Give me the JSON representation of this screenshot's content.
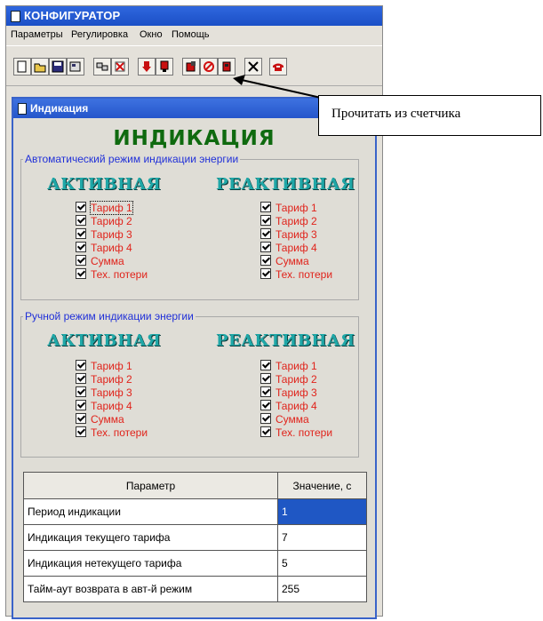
{
  "app": {
    "title": "КОНФИГУРАТОР"
  },
  "menu": [
    "Параметры",
    "Регулировка",
    "Окно",
    "Помощь"
  ],
  "child": {
    "title": "Индикация",
    "heading": "ИНДИКАЦИЯ"
  },
  "auto_group": {
    "legend": "Автоматический режим индикации энергии",
    "active_title": "АКТИВНАЯ",
    "reactive_title": "РЕАКТИВНАЯ",
    "active": [
      "Тариф 1",
      "Тариф 2",
      "Тариф 3",
      "Тариф 4",
      "Сумма",
      "Тех. потери"
    ],
    "reactive": [
      "Тариф 1",
      "Тариф 2",
      "Тариф 3",
      "Тариф 4",
      "Сумма",
      "Тех. потери"
    ]
  },
  "manual_group": {
    "legend": "Ручной режим индикации энергии",
    "active_title": "АКТИВНАЯ",
    "reactive_title": "РЕАКТИВНАЯ",
    "active": [
      "Тариф 1",
      "Тариф 2",
      "Тариф 3",
      "Тариф 4",
      "Сумма",
      "Тех. потери"
    ],
    "reactive": [
      "Тариф 1",
      "Тариф 2",
      "Тариф 3",
      "Тариф 4",
      "Сумма",
      "Тех. потери"
    ]
  },
  "table": {
    "headers": [
      "Параметр",
      "Значение, с"
    ],
    "rows": [
      [
        "Период индикации",
        "1"
      ],
      [
        "Индикация текущего тарифа",
        "7"
      ],
      [
        "Индикация нетекущего тарифа",
        "5"
      ],
      [
        "Тайм-аут возврата в авт-й режим",
        "255"
      ]
    ]
  },
  "callout": {
    "text": "Прочитать из счетчика"
  },
  "icons": {
    "toolbar": [
      "new-file-icon",
      "open-folder-icon",
      "save-icon",
      "properties-icon",
      "network-icon",
      "delete-icon",
      "read-down-icon",
      "write-icon",
      "read-meter-icon",
      "stop-icon",
      "device-icon",
      "close-icon",
      "phone-icon"
    ]
  },
  "colors": {
    "heading": "#0f6a0f",
    "checkbox_label": "#e0231b",
    "legend": "#2030d8",
    "title_bar": "#2556cb",
    "selected_cell": "#1f57c4"
  }
}
